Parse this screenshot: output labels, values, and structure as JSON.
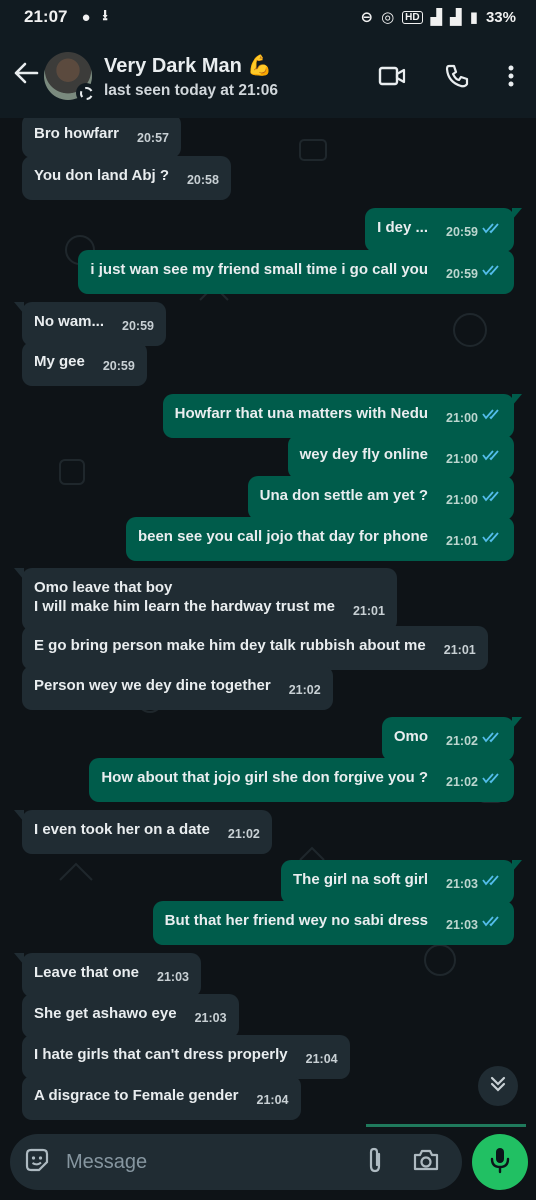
{
  "status_bar": {
    "time": "21:07",
    "battery": "33%",
    "network": "HD"
  },
  "header": {
    "contact_name": "Very Dark Man 💪",
    "last_seen": "last seen today at 21:06"
  },
  "composer": {
    "placeholder": "Message"
  },
  "colors": {
    "incoming": "#202c33",
    "outgoing": "#005c4b",
    "tick_read": "#53bdeb",
    "mic": "#21c063"
  },
  "messages": [
    {
      "dir": "in",
      "text": "Bro howfarr",
      "time": "20:57"
    },
    {
      "dir": "in",
      "text": "You don land Abj ?",
      "time": "20:58"
    },
    {
      "dir": "out",
      "text": "I dey ...",
      "time": "20:59"
    },
    {
      "dir": "out",
      "text": "i just wan see my friend small time i go call you",
      "time": "20:59"
    },
    {
      "dir": "in",
      "text": "No wam...",
      "time": "20:59"
    },
    {
      "dir": "in",
      "text": "My gee",
      "time": "20:59"
    },
    {
      "dir": "out",
      "text": "Howfarr that una matters with Nedu",
      "time": "21:00"
    },
    {
      "dir": "out",
      "text": "wey dey fly online",
      "time": "21:00"
    },
    {
      "dir": "out",
      "text": "Una don settle am yet ?",
      "time": "21:00"
    },
    {
      "dir": "out",
      "text": "been see you call jojo that day for phone",
      "time": "21:01"
    },
    {
      "dir": "in",
      "text": "Omo leave that boy\nI will make him learn the hardway trust me",
      "time": "21:01"
    },
    {
      "dir": "in",
      "text": "E go bring person make him dey talk rubbish about me",
      "time": "21:01"
    },
    {
      "dir": "in",
      "text": "Person wey we dey dine together",
      "time": "21:02"
    },
    {
      "dir": "out",
      "text": "Omo",
      "time": "21:02"
    },
    {
      "dir": "out",
      "text": "How about that jojo girl she don forgive you ?",
      "time": "21:02"
    },
    {
      "dir": "in",
      "text": "I even took her on a date",
      "time": "21:02"
    },
    {
      "dir": "out",
      "text": "The girl na soft girl",
      "time": "21:03"
    },
    {
      "dir": "out",
      "text": "But that her friend wey no sabi dress",
      "time": "21:03"
    },
    {
      "dir": "in",
      "text": "Leave that one",
      "time": "21:03"
    },
    {
      "dir": "in",
      "text": "She get ashawo eye",
      "time": "21:03"
    },
    {
      "dir": "in",
      "text": "I hate girls that can't dress properly",
      "time": "21:04"
    },
    {
      "dir": "in",
      "text": "A disgrace to Female gender",
      "time": "21:04"
    }
  ]
}
